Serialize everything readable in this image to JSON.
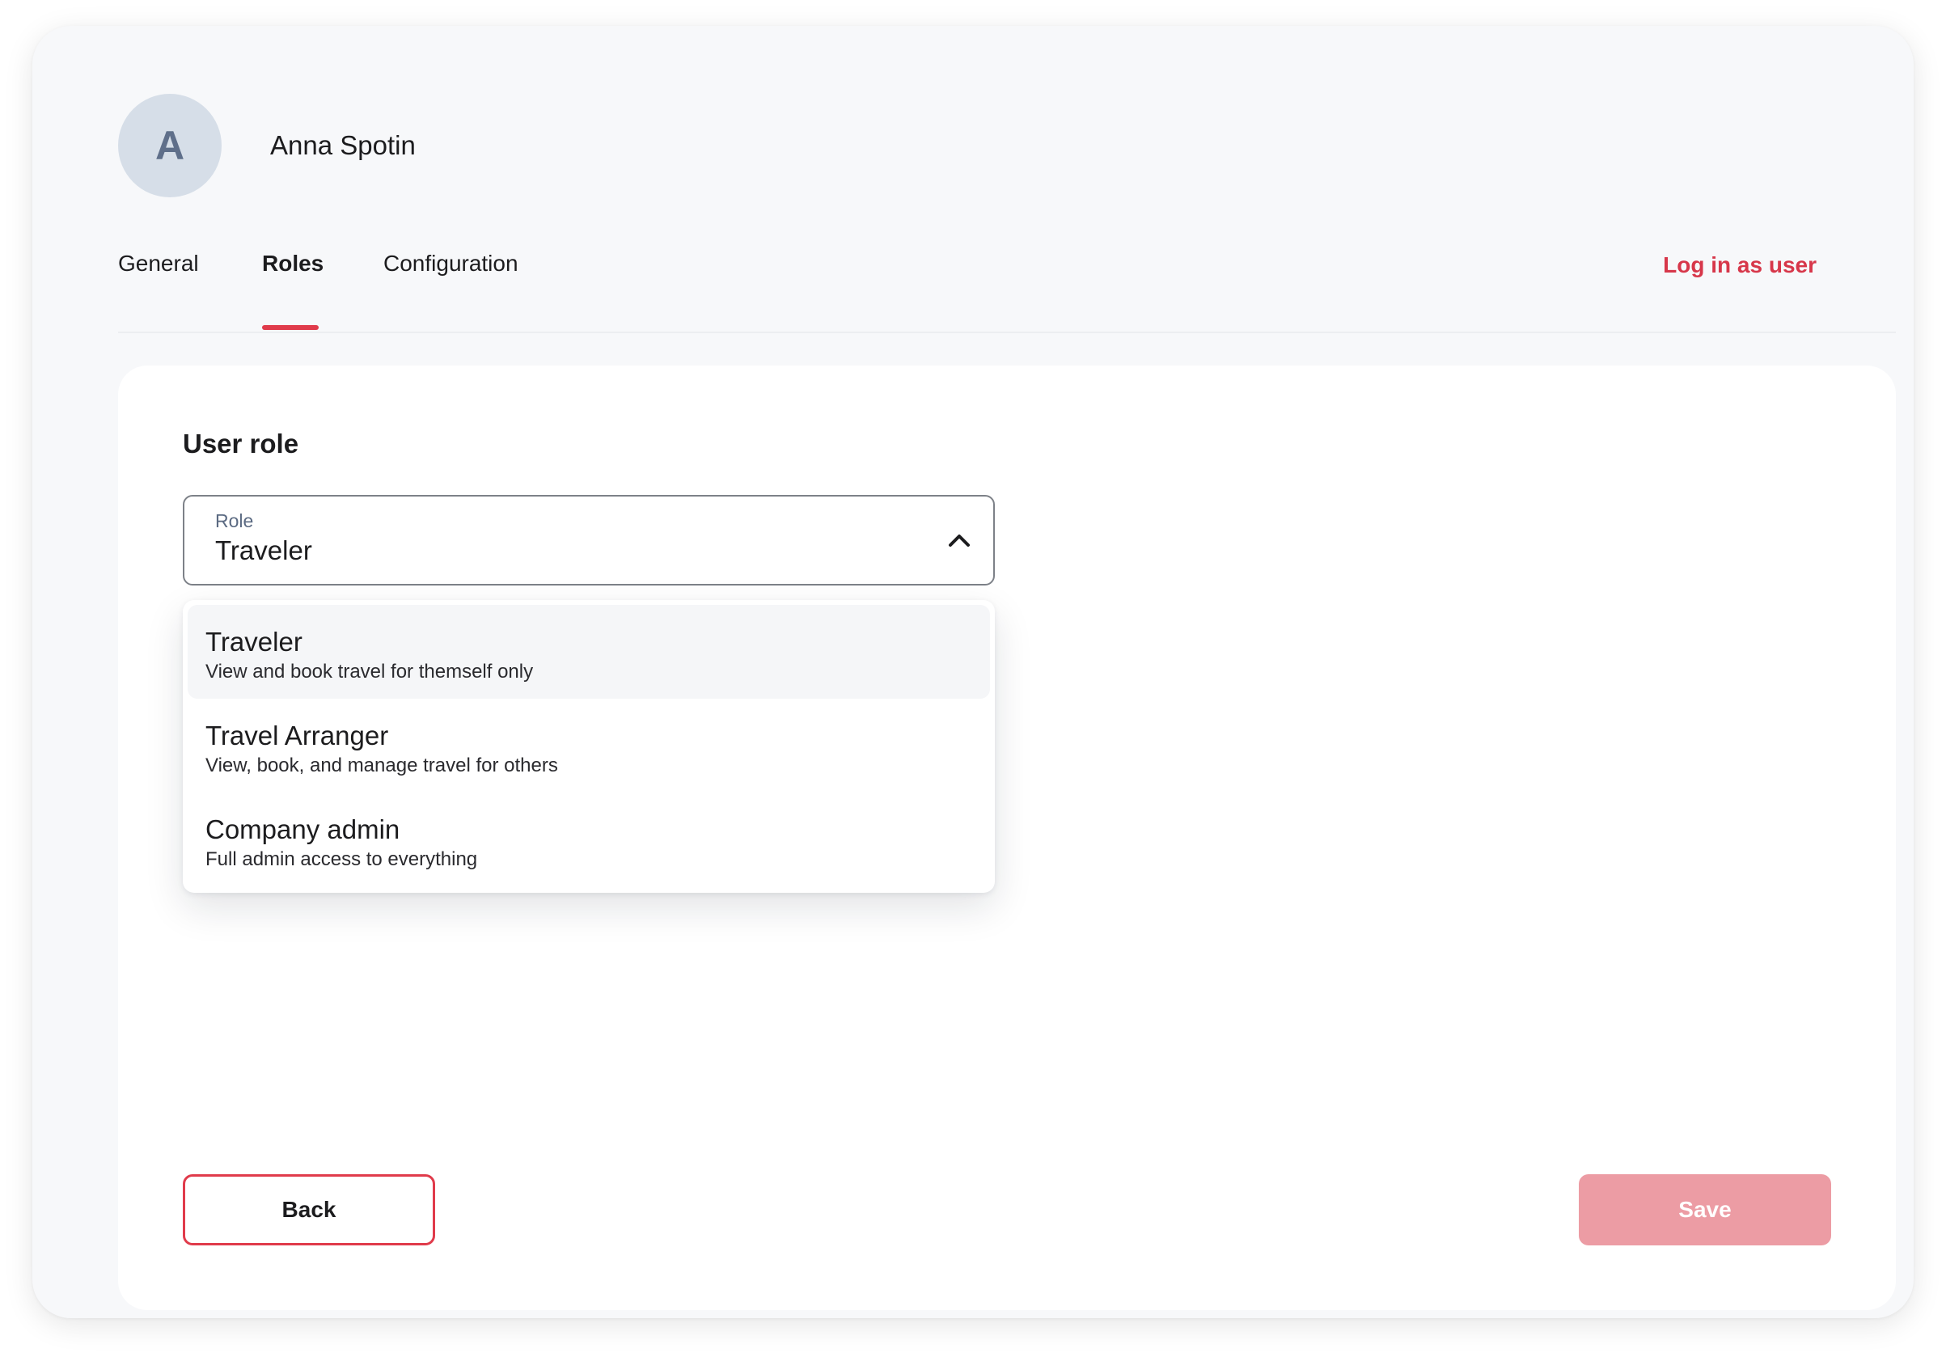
{
  "user": {
    "avatar_initial": "A",
    "name": "Anna Spotin"
  },
  "tabs": [
    {
      "label": "General",
      "active": false
    },
    {
      "label": "Roles",
      "active": true
    },
    {
      "label": "Configuration",
      "active": false
    }
  ],
  "header": {
    "login_as_user": "Log in as user"
  },
  "roles_section": {
    "title": "User role",
    "select": {
      "label": "Role",
      "value": "Traveler",
      "expanded": true,
      "icon": "chevron-up-icon"
    },
    "options": [
      {
        "title": "Traveler",
        "description": "View and book travel for themself only",
        "highlighted": true
      },
      {
        "title": "Travel Arranger",
        "description": "View, book, and manage travel for others",
        "highlighted": false
      },
      {
        "title": "Company admin",
        "description": "Full admin access to everything",
        "highlighted": false
      }
    ]
  },
  "actions": {
    "back_label": "Back",
    "save_label": "Save",
    "save_enabled": false
  },
  "colors": {
    "accent": "#e03b4b",
    "accent_disabled": "#ec9ca4",
    "avatar_bg": "#d6dee8",
    "panel_bg": "#f7f8fa"
  }
}
